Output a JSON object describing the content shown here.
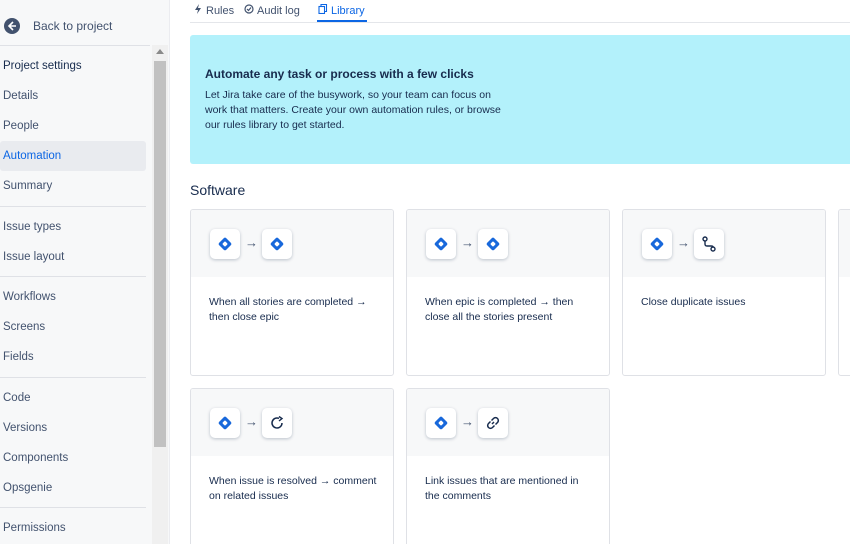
{
  "sidebar": {
    "back_label": "Back to project",
    "items": [
      {
        "label": "Project settings"
      },
      {
        "label": "Details"
      },
      {
        "label": "People"
      },
      {
        "label": "Automation"
      },
      {
        "label": "Summary"
      },
      {
        "label": "Issue types"
      },
      {
        "label": "Issue layout"
      },
      {
        "label": "Workflows"
      },
      {
        "label": "Screens"
      },
      {
        "label": "Fields"
      },
      {
        "label": "Code"
      },
      {
        "label": "Versions"
      },
      {
        "label": "Components"
      },
      {
        "label": "Opsgenie"
      },
      {
        "label": "Permissions"
      }
    ]
  },
  "tabs": [
    {
      "label": "Rules"
    },
    {
      "label": "Audit log"
    },
    {
      "label": "Library"
    }
  ],
  "banner": {
    "title": "Automate any task or process with a few clicks",
    "text": "Let Jira take care of the busywork, so your team can focus on work that matters. Create your own automation rules, or browse our rules library to get started."
  },
  "section": {
    "title": "Software"
  },
  "cards": [
    {
      "text": "When all stories are completed → then close epic",
      "icon_from": "jira-diamond-icon",
      "icon_to": "jira-diamond-icon"
    },
    {
      "text": "When epic is completed → then close all the stories present",
      "icon_from": "jira-diamond-icon",
      "icon_to": "jira-diamond-icon"
    },
    {
      "text": "Close duplicate issues",
      "icon_from": "jira-diamond-icon",
      "icon_to": "branch-icon"
    },
    {
      "text": "When issue is resolved → comment on related issues",
      "icon_from": "jira-diamond-icon",
      "icon_to": "comment-icon"
    },
    {
      "text": "Link issues that are mentioned in the comments",
      "icon_from": "jira-diamond-icon",
      "icon_to": "link-icon"
    }
  ],
  "arrow": "→",
  "colors": {
    "accent": "#0c66e4",
    "banner": "#b3f1fb",
    "jira_blue": "#1868db"
  }
}
